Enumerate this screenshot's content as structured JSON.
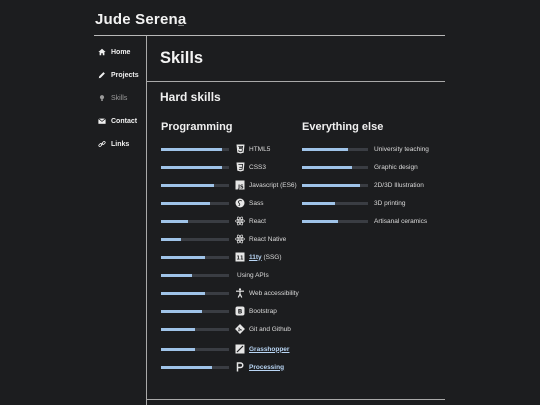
{
  "site": {
    "title": "Jude Serena"
  },
  "nav": {
    "items": [
      {
        "label": "Home",
        "icon": "home-icon"
      },
      {
        "label": "Projects",
        "icon": "pencil-icon"
      },
      {
        "label": "Skills",
        "icon": "lightbulb-icon",
        "active": true
      },
      {
        "label": "Contact",
        "icon": "envelope-icon"
      },
      {
        "label": "Links",
        "icon": "link-icon"
      }
    ]
  },
  "main": {
    "title": "Skills",
    "section_title": "Hard skills",
    "programming": {
      "heading": "Programming",
      "skills": [
        {
          "name": "HTML5",
          "level": 0.9,
          "icon": "html5-icon"
        },
        {
          "name": "CSS3",
          "level": 0.9,
          "icon": "css3-icon"
        },
        {
          "name": "Javascript (ES6)",
          "level": 0.78,
          "icon": "javascript-icon"
        },
        {
          "name": "Sass",
          "level": 0.72,
          "icon": "sass-icon"
        },
        {
          "name": "React",
          "level": 0.4,
          "icon": "react-icon"
        },
        {
          "name": "React Native",
          "level": 0.3,
          "icon": "react-icon"
        },
        {
          "name": "11ty (SSG)",
          "level": 0.65,
          "icon": "eleventy-icon",
          "link_text": "11ty"
        },
        {
          "name": "Using APIs",
          "level": 0.45,
          "icon": ""
        },
        {
          "name": "Web accessibility",
          "level": 0.65,
          "icon": "accessibility-icon"
        },
        {
          "name": "Bootstrap",
          "level": 0.6,
          "icon": "bootstrap-icon"
        },
        {
          "name": "Git and Github",
          "level": 0.5,
          "icon": "git-icon"
        },
        {
          "name": "Grasshopper",
          "level": 0.5,
          "icon": "grasshopper-icon",
          "link": true
        },
        {
          "name": "Processing",
          "level": 0.75,
          "icon": "processing-icon",
          "link": true
        }
      ]
    },
    "everything_else": {
      "heading": "Everything else",
      "skills": [
        {
          "name": "University teaching",
          "level": 0.7
        },
        {
          "name": "Graphic design",
          "level": 0.75
        },
        {
          "name": "2D/3D Illustration",
          "level": 0.88
        },
        {
          "name": "3D printing",
          "level": 0.5
        },
        {
          "name": "Artisanal ceramics",
          "level": 0.55
        }
      ]
    }
  },
  "colors": {
    "background": "#1c1d1f",
    "bar_fill": "#9fc3e8",
    "bar_track": "#3a3d43",
    "link": "#b9d6f5"
  }
}
